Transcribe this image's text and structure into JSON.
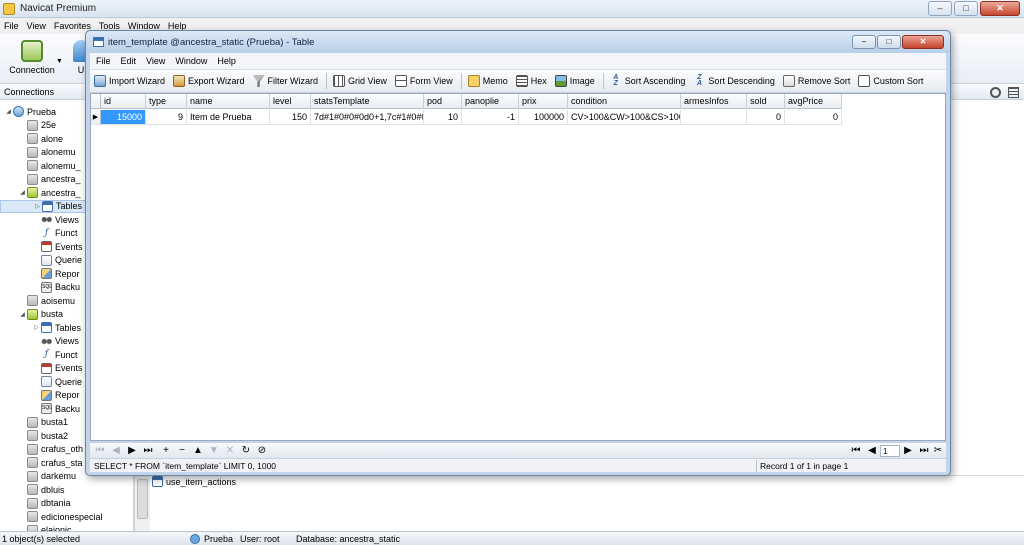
{
  "app": {
    "title": "Navicat Premium"
  },
  "main_menu": [
    "File",
    "View",
    "Favorites",
    "Tools",
    "Window",
    "Help"
  ],
  "main_toolbar": {
    "connection_label": "Connection",
    "user_label": "U"
  },
  "connections_label": "Connections",
  "tree": [
    {
      "label": "Prueba",
      "kind": "conn",
      "expanded": true
    },
    {
      "label": "25e",
      "kind": "db"
    },
    {
      "label": "alone",
      "kind": "db"
    },
    {
      "label": "alonemu",
      "kind": "db"
    },
    {
      "label": "alonemu_",
      "kind": "db"
    },
    {
      "label": "ancestra_",
      "kind": "db"
    },
    {
      "label": "ancestra_",
      "kind": "dbo",
      "expanded": true
    },
    {
      "label": "Tables",
      "kind": "tbl",
      "selected": true
    },
    {
      "label": "Views",
      "kind": "view"
    },
    {
      "label": "Funct",
      "kind": "func"
    },
    {
      "label": "Events",
      "kind": "evt"
    },
    {
      "label": "Querie",
      "kind": "qry"
    },
    {
      "label": "Repor",
      "kind": "rep"
    },
    {
      "label": "Backu",
      "kind": "bak"
    },
    {
      "label": "aoisemu",
      "kind": "db"
    },
    {
      "label": "busta",
      "kind": "dbo",
      "expanded": true
    },
    {
      "label": "Tables",
      "kind": "tbl"
    },
    {
      "label": "Views",
      "kind": "view"
    },
    {
      "label": "Funct",
      "kind": "func"
    },
    {
      "label": "Events",
      "kind": "evt"
    },
    {
      "label": "Querie",
      "kind": "qry"
    },
    {
      "label": "Repor",
      "kind": "rep"
    },
    {
      "label": "Backu",
      "kind": "bak"
    },
    {
      "label": "busta1",
      "kind": "db"
    },
    {
      "label": "busta2",
      "kind": "db"
    },
    {
      "label": "crafus_oth",
      "kind": "db"
    },
    {
      "label": "crafus_sta",
      "kind": "db"
    },
    {
      "label": "darkemu",
      "kind": "db"
    },
    {
      "label": "dbluis",
      "kind": "db"
    },
    {
      "label": "dbtania",
      "kind": "db"
    },
    {
      "label": "edicionespecial",
      "kind": "db"
    },
    {
      "label": "elaionic",
      "kind": "db"
    }
  ],
  "lower_pane_item": "use_item_actions",
  "status": {
    "selected": "1 object(s) selected",
    "connection": "Prueba",
    "user": "User: root",
    "database": "Database: ancestra_static"
  },
  "child": {
    "title": "item_template @ancestra_static (Prueba) - Table",
    "menu": [
      "File",
      "Edit",
      "View",
      "Window",
      "Help"
    ],
    "toolbar": [
      {
        "label": "Import Wizard",
        "icon": "import-icon"
      },
      {
        "label": "Export Wizard",
        "icon": "export-icon"
      },
      {
        "label": "Filter Wizard",
        "icon": "filter-icon"
      },
      {
        "label": "Grid View",
        "icon": "grid-view-icon"
      },
      {
        "label": "Form View",
        "icon": "form-view-icon"
      },
      {
        "label": "Memo",
        "icon": "memo-icon"
      },
      {
        "label": "Hex",
        "icon": "hex-icon"
      },
      {
        "label": "Image",
        "icon": "image-icon"
      },
      {
        "label": "Sort Ascending",
        "icon": "sort-ascending-icon"
      },
      {
        "label": "Sort Descending",
        "icon": "sort-descending-icon"
      },
      {
        "label": "Remove Sort",
        "icon": "remove-sort-icon"
      },
      {
        "label": "Custom Sort",
        "icon": "custom-sort-icon"
      }
    ],
    "columns": [
      "id",
      "type",
      "name",
      "level",
      "statsTemplate",
      "pod",
      "panoplie",
      "prix",
      "condition",
      "armesInfos",
      "sold",
      "avgPrice"
    ],
    "rows": [
      [
        "15000",
        "9",
        "Item de Prueba",
        "150",
        "7d#1#0#0#0d0+1,7c#1#0#0",
        "10",
        "-1",
        "100000",
        "CV>100&CW>100&CS>100",
        "",
        "0",
        "0"
      ]
    ],
    "page_number": "1",
    "sql": "SELECT * FROM `item_template` LIMIT 0, 1000",
    "record_info": "Record 1 of 1 in page 1"
  }
}
